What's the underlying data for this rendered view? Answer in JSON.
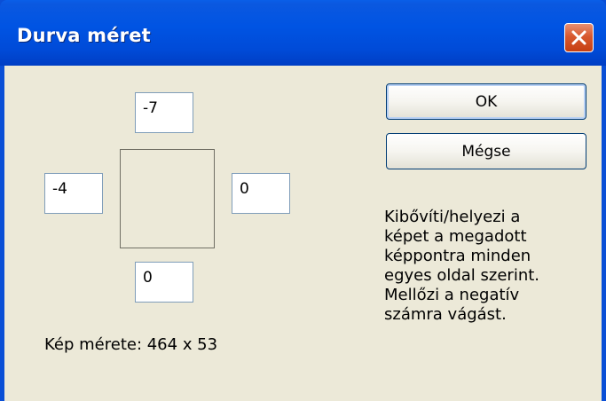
{
  "window": {
    "title": "Durva méret",
    "close_icon": "close-icon"
  },
  "margins": {
    "top": "-7",
    "left": "-4",
    "right": "0",
    "bottom": "0"
  },
  "image_size_text": "Kép mérete: 464 x 53",
  "buttons": {
    "ok_label": "OK",
    "cancel_label": "Mégse"
  },
  "description": "Kibővíti/helyezi a\nképet a megadott\nképpontra minden\negyes oldal szerint.\nMellőzi a negatív\nszámra vágást.",
  "colors": {
    "titlebar": "#0054e3",
    "dialog_background": "#ece9d8",
    "close_button": "#d8592f",
    "input_border": "#7f9db9"
  }
}
